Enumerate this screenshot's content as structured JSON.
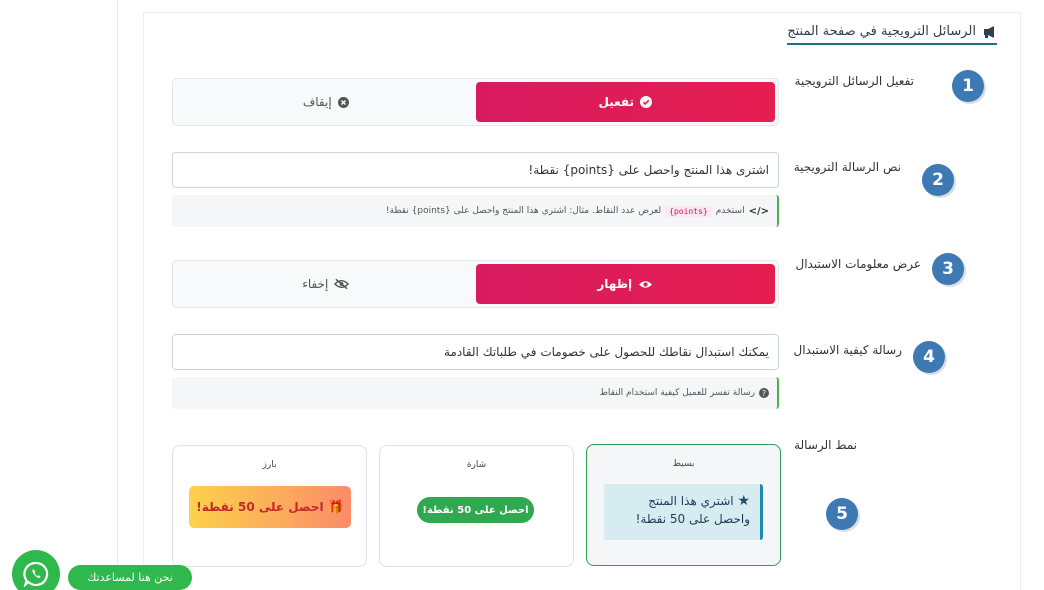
{
  "section": {
    "title": "الرسائل الترويجية في صفحة المنتج",
    "icon": "megaphone-icon"
  },
  "fields": {
    "activate": {
      "label": "تفعيل الرسائل الترويجية",
      "step": "1",
      "on_label": "تفعيل",
      "off_label": "إيقاف",
      "selected": "on"
    },
    "message": {
      "label": "نص الرسالة الترويجية",
      "step": "2",
      "value": "اشترى هذا المنتج واحصل على {points} نقطة!",
      "hint_prefix": "استخدم",
      "hint_code": "{points}",
      "hint_suffix": "لعرض عدد النقاط. مثال: اشتري هذا المنتج واحصل على {points} نقطة!"
    },
    "show_redeem": {
      "label": "عرض معلومات الاستبدال",
      "step": "3",
      "on_label": "إظهار",
      "off_label": "إخفاء",
      "selected": "on"
    },
    "redeem_message": {
      "label": "رسالة كيفية الاستبدال",
      "step": "4",
      "value": "يمكنك استبدال نقاطك للحصول على خصومات في طلباتك القادمة",
      "hint": "رسالة تفسر للعميل كيفية استخدام النقاط"
    },
    "style": {
      "label": "نمط الرسالة",
      "step": "5",
      "options": [
        {
          "title": "بسيط",
          "preview": "اشتري هذا المنتج واحصل على 50 نقطة!",
          "selected": true
        },
        {
          "title": "شارة",
          "preview": "احصل على 50 نقطة!",
          "selected": false
        },
        {
          "title": "بارز",
          "preview": "احصل على 50 نقطة!",
          "selected": false
        }
      ]
    }
  },
  "help": {
    "label": "نحن هنا لمساعدتك"
  },
  "colors": {
    "accent": "#e11d5a",
    "step_badge": "#3d79b3",
    "success": "#2fa84f",
    "whatsapp": "#2fb84c"
  }
}
